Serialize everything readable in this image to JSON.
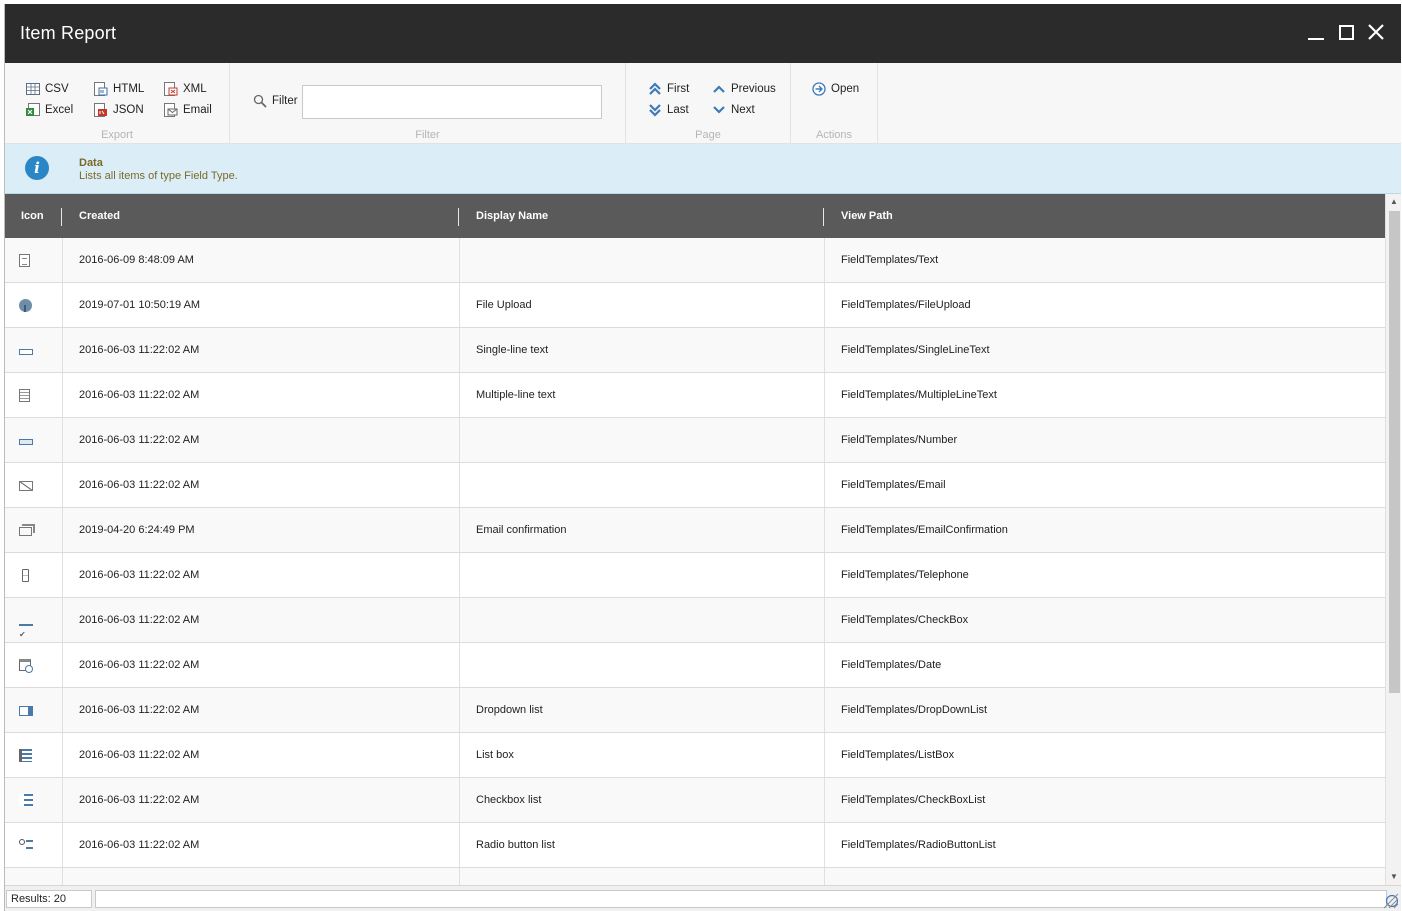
{
  "window": {
    "title": "Item Report"
  },
  "ribbon": {
    "export": {
      "label": "Export",
      "csv": "CSV",
      "excel": "Excel",
      "html": "HTML",
      "json": "JSON",
      "xml": "XML",
      "email": "Email"
    },
    "filter": {
      "label": "Filter",
      "button": "Filter",
      "value": ""
    },
    "page": {
      "label": "Page",
      "first": "First",
      "last": "Last",
      "previous": "Previous",
      "next": "Next"
    },
    "actions": {
      "label": "Actions",
      "open": "Open"
    }
  },
  "info": {
    "title": "Data",
    "text": "Lists all items of type Field Type."
  },
  "grid": {
    "columns": {
      "icon": "Icon",
      "created": "Created",
      "display_name": "Display Name",
      "view_path": "View Path"
    },
    "rows": [
      {
        "icon": "text-icon",
        "created": "2016-06-09 8:48:09 AM",
        "display_name": "",
        "view_path": "FieldTemplates/Text"
      },
      {
        "icon": "file-upload-icon",
        "created": "2019-07-01 10:50:19 AM",
        "display_name": "File Upload",
        "view_path": "FieldTemplates/FileUpload"
      },
      {
        "icon": "single-line-text-icon",
        "created": "2016-06-03 11:22:02 AM",
        "display_name": "Single-line text",
        "view_path": "FieldTemplates/SingleLineText"
      },
      {
        "icon": "multiple-line-text-icon",
        "created": "2016-06-03 11:22:02 AM",
        "display_name": "Multiple-line text",
        "view_path": "FieldTemplates/MultipleLineText"
      },
      {
        "icon": "number-icon",
        "created": "2016-06-03 11:22:02 AM",
        "display_name": "",
        "view_path": "FieldTemplates/Number"
      },
      {
        "icon": "email-icon",
        "created": "2016-06-03 11:22:02 AM",
        "display_name": "",
        "view_path": "FieldTemplates/Email"
      },
      {
        "icon": "email-confirmation-icon",
        "created": "2019-04-20 6:24:49 PM",
        "display_name": "Email confirmation",
        "view_path": "FieldTemplates/EmailConfirmation"
      },
      {
        "icon": "telephone-icon",
        "created": "2016-06-03 11:22:02 AM",
        "display_name": "",
        "view_path": "FieldTemplates/Telephone"
      },
      {
        "icon": "checkbox-icon",
        "created": "2016-06-03 11:22:02 AM",
        "display_name": "",
        "view_path": "FieldTemplates/CheckBox"
      },
      {
        "icon": "date-icon",
        "created": "2016-06-03 11:22:02 AM",
        "display_name": "",
        "view_path": "FieldTemplates/Date"
      },
      {
        "icon": "dropdown-list-icon",
        "created": "2016-06-03 11:22:02 AM",
        "display_name": "Dropdown list",
        "view_path": "FieldTemplates/DropDownList"
      },
      {
        "icon": "list-box-icon",
        "created": "2016-06-03 11:22:02 AM",
        "display_name": "List box",
        "view_path": "FieldTemplates/ListBox"
      },
      {
        "icon": "checkbox-list-icon",
        "created": "2016-06-03 11:22:02 AM",
        "display_name": "Checkbox list",
        "view_path": "FieldTemplates/CheckBoxList"
      },
      {
        "icon": "radio-button-list-icon",
        "created": "2016-06-03 11:22:02 AM",
        "display_name": "Radio button list",
        "view_path": "FieldTemplates/RadioButtonList"
      }
    ]
  },
  "status": {
    "results": "Results: 20"
  },
  "colors": {
    "titlebar": "#2b2b2b",
    "grid_header": "#5a5a5a",
    "info_bg": "#dbeef8",
    "info_text": "#7a6a2a",
    "accent": "#2a86c4"
  }
}
